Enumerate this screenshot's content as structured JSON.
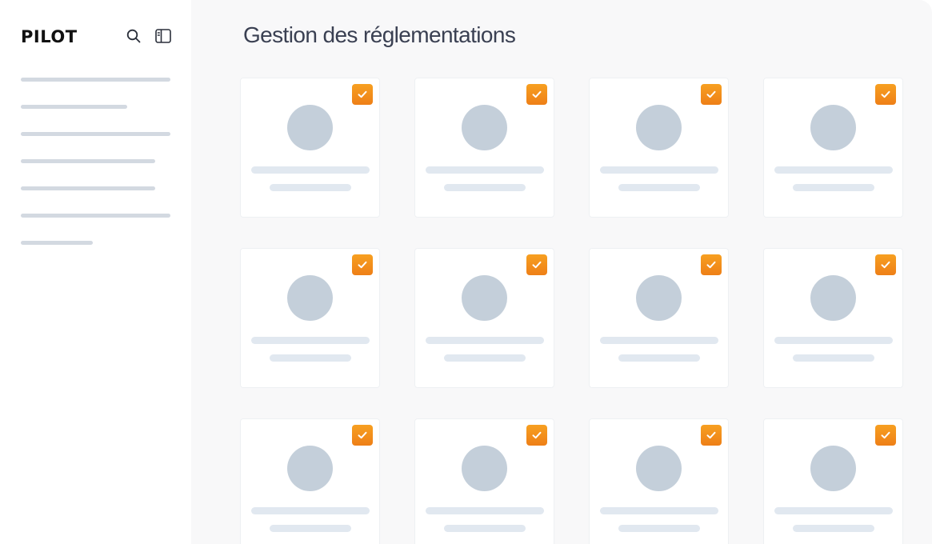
{
  "sidebar": {
    "logo": "PILOT",
    "icons": {
      "search": "search-icon",
      "panel": "sidebar-toggle-icon"
    },
    "nav_placeholders": [
      {
        "width_ratio": 1.0
      },
      {
        "width_ratio": 0.71
      },
      {
        "width_ratio": 1.0
      },
      {
        "width_ratio": 0.9
      },
      {
        "width_ratio": 0.9
      },
      {
        "width_ratio": 1.0
      },
      {
        "width_ratio": 0.48
      }
    ]
  },
  "main": {
    "title": "Gestion des réglementations",
    "cards": [
      {
        "checked": true
      },
      {
        "checked": true
      },
      {
        "checked": true
      },
      {
        "checked": true
      },
      {
        "checked": true
      },
      {
        "checked": true
      },
      {
        "checked": true
      },
      {
        "checked": true
      },
      {
        "checked": true
      },
      {
        "checked": true
      },
      {
        "checked": true
      },
      {
        "checked": true
      }
    ]
  },
  "colors": {
    "accent": "#f18b1b",
    "skeleton_avatar": "#c4cfda",
    "skeleton_line": "#e1e8f0",
    "main_bg": "#f8f8f9",
    "title": "#3a4052"
  }
}
